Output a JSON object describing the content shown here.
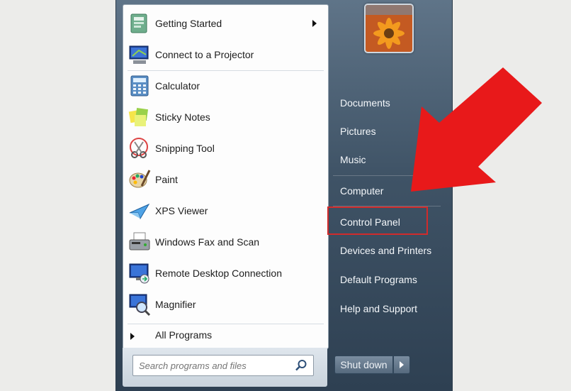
{
  "programs": [
    {
      "label": "Getting Started",
      "icon": "getting-started-icon",
      "has_submenu": true
    },
    {
      "label": "Connect to a Projector",
      "icon": "projector-icon",
      "has_submenu": false
    },
    {
      "label": "Calculator",
      "icon": "calculator-icon",
      "has_submenu": false
    },
    {
      "label": "Sticky Notes",
      "icon": "sticky-notes-icon",
      "has_submenu": false
    },
    {
      "label": "Snipping Tool",
      "icon": "snipping-tool-icon",
      "has_submenu": false
    },
    {
      "label": "Paint",
      "icon": "paint-icon",
      "has_submenu": false
    },
    {
      "label": "XPS Viewer",
      "icon": "xps-viewer-icon",
      "has_submenu": false
    },
    {
      "label": "Windows Fax and Scan",
      "icon": "fax-scan-icon",
      "has_submenu": false
    },
    {
      "label": "Remote Desktop Connection",
      "icon": "remote-desktop-icon",
      "has_submenu": false
    },
    {
      "label": "Magnifier",
      "icon": "magnifier-icon",
      "has_submenu": false
    }
  ],
  "all_programs_label": "All Programs",
  "search": {
    "placeholder": "Search programs and files"
  },
  "right_panel": {
    "items": [
      {
        "label": "Documents"
      },
      {
        "label": "Pictures"
      },
      {
        "label": "Music"
      },
      {
        "label": "Computer"
      },
      {
        "label": "Control Panel"
      },
      {
        "label": "Devices and Printers"
      },
      {
        "label": "Default Programs"
      },
      {
        "label": "Help and Support"
      }
    ]
  },
  "shutdown_label": "Shut down",
  "colors": {
    "highlight": "#d12b2b",
    "arrow": "#e8191a"
  }
}
